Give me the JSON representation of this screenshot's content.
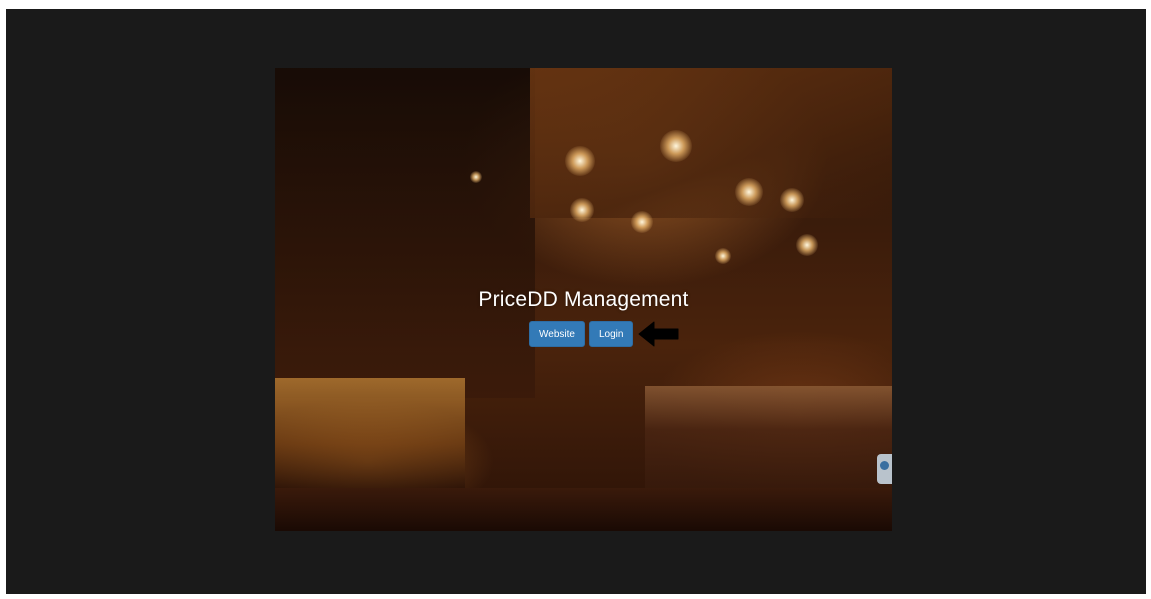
{
  "hero": {
    "title": "PriceDD Management"
  },
  "buttons": {
    "website_label": "Website",
    "login_label": "Login"
  },
  "colors": {
    "page_background": "#1a1a1a",
    "button_primary": "#337ab7",
    "title_text": "#ffffff"
  },
  "icons": {
    "pointer": "arrow-left-icon",
    "side_widget": "feedback-tab-icon"
  }
}
